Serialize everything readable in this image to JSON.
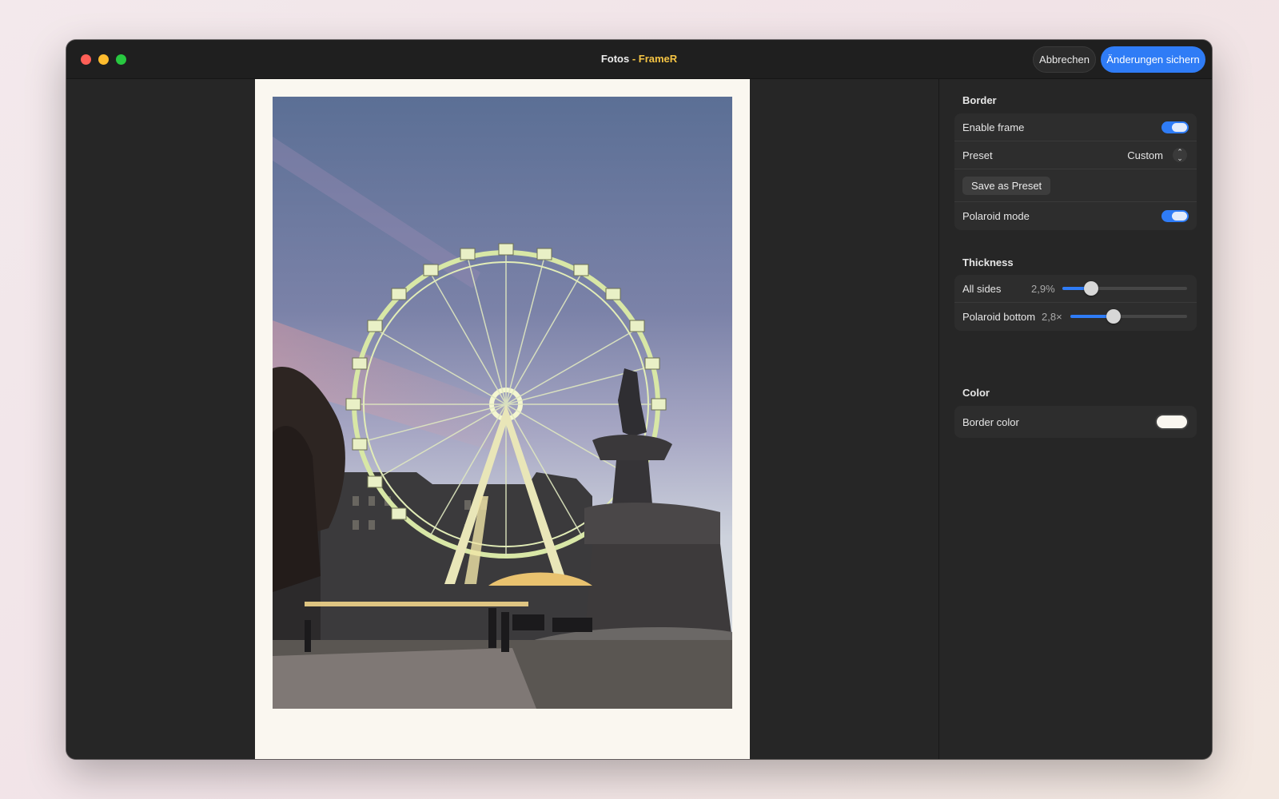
{
  "window": {
    "title_prefix": "Fotos",
    "title_app": " - FrameR",
    "cancel_label": "Abbrechen",
    "save_label": "Änderungen sichern"
  },
  "inspector": {
    "border": {
      "title": "Border",
      "enable_frame_label": "Enable frame",
      "enable_frame_on": true,
      "preset_label": "Preset",
      "preset_value": "Custom",
      "save_preset_label": "Save as Preset",
      "polaroid_mode_label": "Polaroid mode",
      "polaroid_mode_on": true
    },
    "thickness": {
      "title": "Thickness",
      "all_sides_label": "All sides",
      "all_sides_value": "2,9%",
      "all_sides_level": 0.23,
      "polaroid_bottom_label": "Polaroid bottom",
      "polaroid_bottom_value": "2,8×",
      "polaroid_bottom_level": 0.37
    },
    "color": {
      "title": "Color",
      "border_color_label": "Border color",
      "border_color": "#faf7f0"
    }
  },
  "colors": {
    "accent": "#2f7cf6",
    "title_app": "#f5c444",
    "frame": "#faf7f0"
  }
}
